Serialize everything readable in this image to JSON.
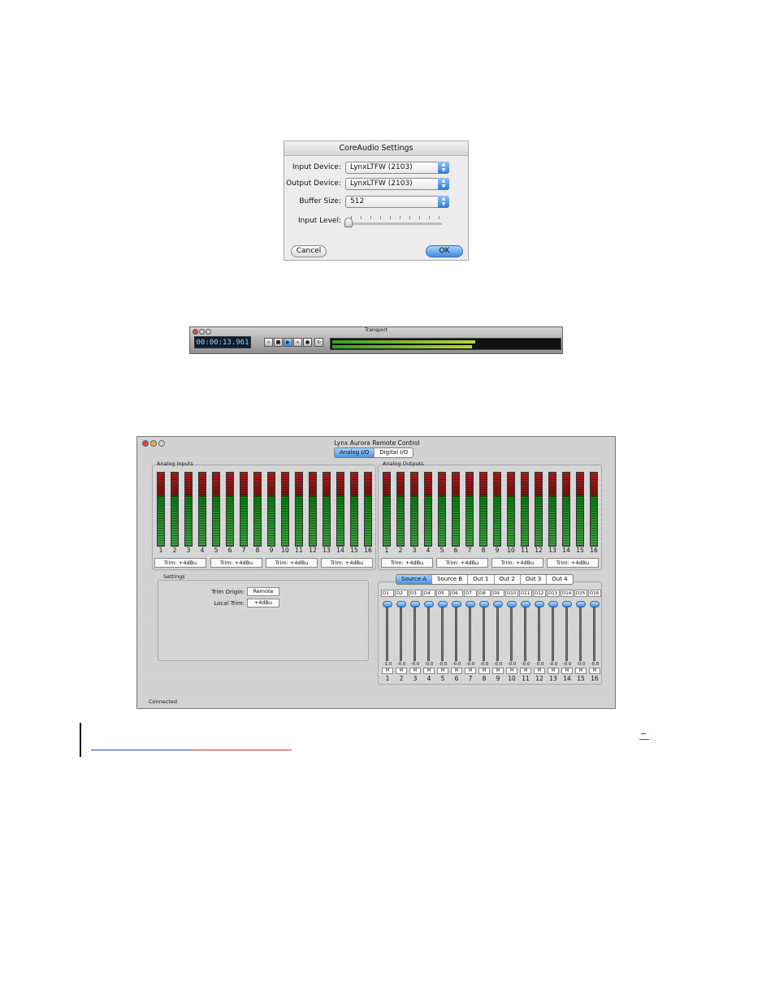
{
  "coreaudio": {
    "title": "CoreAudio Settings",
    "input_label": "Input Device:",
    "input_value": "LynxLTFW (2103)",
    "output_label": "Output Device:",
    "output_value": "LynxLTFW (2103)",
    "buffer_label": "Buffer Size:",
    "buffer_value": "512",
    "level_label": "Input Level:",
    "input_level": 0,
    "cancel": "Cancel",
    "ok": "OK"
  },
  "transport": {
    "title": "Transport",
    "time": "00:00:13.961"
  },
  "aurora": {
    "title": "Lynx Aurora Remote Control",
    "tabs": [
      "Analog I/O",
      "Digital I/O"
    ],
    "analog_inputs": "Analog Inputs",
    "analog_outputs": "Analog Outputs",
    "channels": [
      "1",
      "2",
      "3",
      "4",
      "5",
      "6",
      "7",
      "8",
      "9",
      "10",
      "11",
      "12",
      "13",
      "14",
      "15",
      "16"
    ],
    "trim": "Trim: +4dBu",
    "settings_label": "Settings",
    "trim_origin_label": "Trim Origin:",
    "trim_origin_value": "Remote",
    "local_trim_label": "Local Trim:",
    "local_trim_value": "+4dBu",
    "source_tabs": [
      "Source A",
      "Source B",
      "Out 1",
      "Out 2",
      "Out 3",
      "Out 4"
    ],
    "sources": [
      "D1",
      "D2",
      "D3",
      "D4",
      "D5",
      "D6",
      "D7",
      "D8",
      "D9",
      "D10",
      "D11",
      "D12",
      "D13",
      "D14",
      "D15",
      "D16"
    ],
    "fader_values": [
      "-1.0",
      "-0.0",
      "-0.0",
      "-0.0",
      "-0.0",
      "-0.0",
      "-0.0",
      "-0.0",
      "-0.0",
      "-0.0",
      "-0.0",
      "-0.0",
      "-0.0",
      "-0.0",
      "-0.0",
      "-0.8"
    ],
    "mute": "M",
    "status": "Connected"
  },
  "colors": {
    "accent": "#3d8de0",
    "meter_green": "#0b7d12",
    "meter_red": "#b11c1c"
  }
}
